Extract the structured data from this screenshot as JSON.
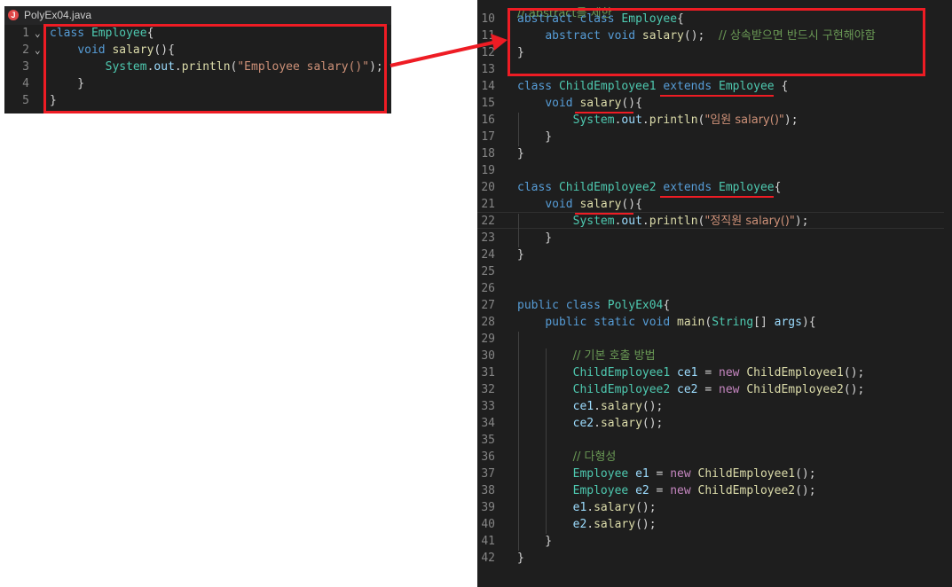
{
  "left_editor": {
    "tab_icon": "J",
    "tab_label": "PolyEx04.java",
    "lines": [
      {
        "num": "1",
        "tokens": [
          {
            "t": "class ",
            "c": "kw"
          },
          {
            "t": "Employee",
            "c": "cls"
          },
          {
            "t": "{",
            "c": "pl"
          }
        ]
      },
      {
        "num": "2",
        "tokens": [
          {
            "t": "    ",
            "c": "pl"
          },
          {
            "t": "void ",
            "c": "kw"
          },
          {
            "t": "salary",
            "c": "fn"
          },
          {
            "t": "(){",
            "c": "pl"
          }
        ]
      },
      {
        "num": "3",
        "tokens": [
          {
            "t": "        ",
            "c": "pl"
          },
          {
            "t": "System",
            "c": "cls"
          },
          {
            "t": ".",
            "c": "pl"
          },
          {
            "t": "out",
            "c": "vr"
          },
          {
            "t": ".",
            "c": "pl"
          },
          {
            "t": "println",
            "c": "fn"
          },
          {
            "t": "(",
            "c": "pl"
          },
          {
            "t": "\"Employee salary()\"",
            "c": "str"
          },
          {
            "t": ");",
            "c": "pl"
          }
        ]
      },
      {
        "num": "4",
        "tokens": [
          {
            "t": "    }",
            "c": "pl"
          }
        ]
      },
      {
        "num": "5",
        "tokens": [
          {
            "t": "}",
            "c": "pl"
          }
        ]
      }
    ]
  },
  "right_editor": {
    "top_partial": "// abstract를 제한",
    "lines": [
      {
        "num": "10",
        "tokens": [
          {
            "t": "abstract ",
            "c": "kw"
          },
          {
            "t": "class ",
            "c": "kw"
          },
          {
            "t": "Employee",
            "c": "cls"
          },
          {
            "t": "{",
            "c": "pl"
          }
        ]
      },
      {
        "num": "11",
        "tokens": [
          {
            "t": "    ",
            "c": "pl"
          },
          {
            "t": "abstract ",
            "c": "kw"
          },
          {
            "t": "void ",
            "c": "kw"
          },
          {
            "t": "salary",
            "c": "fn"
          },
          {
            "t": "();  ",
            "c": "pl"
          },
          {
            "t": "// 상속받으면 반드시 구현해야함",
            "c": "cm"
          }
        ]
      },
      {
        "num": "12",
        "tokens": [
          {
            "t": "}",
            "c": "pl"
          }
        ]
      },
      {
        "num": "13",
        "tokens": []
      },
      {
        "num": "14",
        "tokens": [
          {
            "t": "class ",
            "c": "kw"
          },
          {
            "t": "ChildEmployee1 ",
            "c": "cls"
          },
          {
            "t": "extends ",
            "c": "kw"
          },
          {
            "t": "Employee",
            "c": "cls"
          },
          {
            "t": " {",
            "c": "pl"
          }
        ]
      },
      {
        "num": "15",
        "tokens": [
          {
            "t": "    ",
            "c": "pl"
          },
          {
            "t": "void ",
            "c": "kw"
          },
          {
            "t": "salary",
            "c": "fn"
          },
          {
            "t": "(){",
            "c": "pl"
          }
        ]
      },
      {
        "num": "16",
        "tokens": [
          {
            "t": "        ",
            "c": "pl"
          },
          {
            "t": "System",
            "c": "cls"
          },
          {
            "t": ".",
            "c": "pl"
          },
          {
            "t": "out",
            "c": "vr"
          },
          {
            "t": ".",
            "c": "pl"
          },
          {
            "t": "println",
            "c": "fn"
          },
          {
            "t": "(",
            "c": "pl"
          },
          {
            "t": "\"임원 salary()\"",
            "c": "str"
          },
          {
            "t": ");",
            "c": "pl"
          }
        ]
      },
      {
        "num": "17",
        "tokens": [
          {
            "t": "    }",
            "c": "pl"
          }
        ]
      },
      {
        "num": "18",
        "tokens": [
          {
            "t": "}",
            "c": "pl"
          }
        ]
      },
      {
        "num": "19",
        "tokens": []
      },
      {
        "num": "20",
        "tokens": [
          {
            "t": "class ",
            "c": "kw"
          },
          {
            "t": "ChildEmployee2 ",
            "c": "cls"
          },
          {
            "t": "extends ",
            "c": "kw"
          },
          {
            "t": "Employee",
            "c": "cls"
          },
          {
            "t": "{",
            "c": "pl"
          }
        ]
      },
      {
        "num": "21",
        "tokens": [
          {
            "t": "    ",
            "c": "pl"
          },
          {
            "t": "void ",
            "c": "kw"
          },
          {
            "t": "salary",
            "c": "fn"
          },
          {
            "t": "(){",
            "c": "pl"
          }
        ]
      },
      {
        "num": "22",
        "tokens": [
          {
            "t": "        ",
            "c": "pl"
          },
          {
            "t": "System",
            "c": "cls"
          },
          {
            "t": ".",
            "c": "pl"
          },
          {
            "t": "out",
            "c": "vr"
          },
          {
            "t": ".",
            "c": "pl"
          },
          {
            "t": "println",
            "c": "fn"
          },
          {
            "t": "(",
            "c": "pl"
          },
          {
            "t": "\"정직원 salary()\"",
            "c": "str"
          },
          {
            "t": ");",
            "c": "pl"
          }
        ]
      },
      {
        "num": "23",
        "tokens": [
          {
            "t": "    }",
            "c": "pl"
          }
        ]
      },
      {
        "num": "24",
        "tokens": [
          {
            "t": "}",
            "c": "pl"
          }
        ]
      },
      {
        "num": "25",
        "tokens": []
      },
      {
        "num": "26",
        "tokens": []
      },
      {
        "num": "27",
        "tokens": [
          {
            "t": "public ",
            "c": "kw"
          },
          {
            "t": "class ",
            "c": "kw"
          },
          {
            "t": "PolyEx04",
            "c": "cls"
          },
          {
            "t": "{",
            "c": "pl"
          }
        ]
      },
      {
        "num": "28",
        "tokens": [
          {
            "t": "    ",
            "c": "pl"
          },
          {
            "t": "public ",
            "c": "kw"
          },
          {
            "t": "static ",
            "c": "kw"
          },
          {
            "t": "void ",
            "c": "kw"
          },
          {
            "t": "main",
            "c": "fn"
          },
          {
            "t": "(",
            "c": "pl"
          },
          {
            "t": "String",
            "c": "cls"
          },
          {
            "t": "[] ",
            "c": "pl"
          },
          {
            "t": "args",
            "c": "vr"
          },
          {
            "t": "){",
            "c": "pl"
          }
        ]
      },
      {
        "num": "29",
        "tokens": []
      },
      {
        "num": "30",
        "tokens": [
          {
            "t": "        ",
            "c": "pl"
          },
          {
            "t": "// 기본 호출 방법",
            "c": "cm"
          }
        ]
      },
      {
        "num": "31",
        "tokens": [
          {
            "t": "        ",
            "c": "pl"
          },
          {
            "t": "ChildEmployee1 ",
            "c": "cls"
          },
          {
            "t": "ce1",
            "c": "vr"
          },
          {
            "t": " = ",
            "c": "pl"
          },
          {
            "t": "new ",
            "c": "kw2"
          },
          {
            "t": "ChildEmployee1",
            "c": "fn"
          },
          {
            "t": "();",
            "c": "pl"
          }
        ]
      },
      {
        "num": "32",
        "tokens": [
          {
            "t": "        ",
            "c": "pl"
          },
          {
            "t": "ChildEmployee2 ",
            "c": "cls"
          },
          {
            "t": "ce2",
            "c": "vr"
          },
          {
            "t": " = ",
            "c": "pl"
          },
          {
            "t": "new ",
            "c": "kw2"
          },
          {
            "t": "ChildEmployee2",
            "c": "fn"
          },
          {
            "t": "();",
            "c": "pl"
          }
        ]
      },
      {
        "num": "33",
        "tokens": [
          {
            "t": "        ",
            "c": "pl"
          },
          {
            "t": "ce1",
            "c": "vr"
          },
          {
            "t": ".",
            "c": "pl"
          },
          {
            "t": "salary",
            "c": "fn"
          },
          {
            "t": "();",
            "c": "pl"
          }
        ]
      },
      {
        "num": "34",
        "tokens": [
          {
            "t": "        ",
            "c": "pl"
          },
          {
            "t": "ce2",
            "c": "vr"
          },
          {
            "t": ".",
            "c": "pl"
          },
          {
            "t": "salary",
            "c": "fn"
          },
          {
            "t": "();",
            "c": "pl"
          }
        ]
      },
      {
        "num": "35",
        "tokens": []
      },
      {
        "num": "36",
        "tokens": [
          {
            "t": "        ",
            "c": "pl"
          },
          {
            "t": "// 다형성",
            "c": "cm"
          }
        ]
      },
      {
        "num": "37",
        "tokens": [
          {
            "t": "        ",
            "c": "pl"
          },
          {
            "t": "Employee ",
            "c": "cls"
          },
          {
            "t": "e1",
            "c": "vr"
          },
          {
            "t": " = ",
            "c": "pl"
          },
          {
            "t": "new ",
            "c": "kw2"
          },
          {
            "t": "ChildEmployee1",
            "c": "fn"
          },
          {
            "t": "();",
            "c": "pl"
          }
        ]
      },
      {
        "num": "38",
        "tokens": [
          {
            "t": "        ",
            "c": "pl"
          },
          {
            "t": "Employee ",
            "c": "cls"
          },
          {
            "t": "e2",
            "c": "vr"
          },
          {
            "t": " = ",
            "c": "pl"
          },
          {
            "t": "new ",
            "c": "kw2"
          },
          {
            "t": "ChildEmployee2",
            "c": "fn"
          },
          {
            "t": "();",
            "c": "pl"
          }
        ]
      },
      {
        "num": "39",
        "tokens": [
          {
            "t": "        ",
            "c": "pl"
          },
          {
            "t": "e1",
            "c": "vr"
          },
          {
            "t": ".",
            "c": "pl"
          },
          {
            "t": "salary",
            "c": "fn"
          },
          {
            "t": "();",
            "c": "pl"
          }
        ]
      },
      {
        "num": "40",
        "tokens": [
          {
            "t": "        ",
            "c": "pl"
          },
          {
            "t": "e2",
            "c": "vr"
          },
          {
            "t": ".",
            "c": "pl"
          },
          {
            "t": "salary",
            "c": "fn"
          },
          {
            "t": "();",
            "c": "pl"
          }
        ]
      },
      {
        "num": "41",
        "tokens": [
          {
            "t": "    }",
            "c": "pl"
          }
        ]
      },
      {
        "num": "42",
        "tokens": [
          {
            "t": "}",
            "c": "pl"
          }
        ]
      }
    ]
  },
  "annotation_color": "#ee1c24"
}
